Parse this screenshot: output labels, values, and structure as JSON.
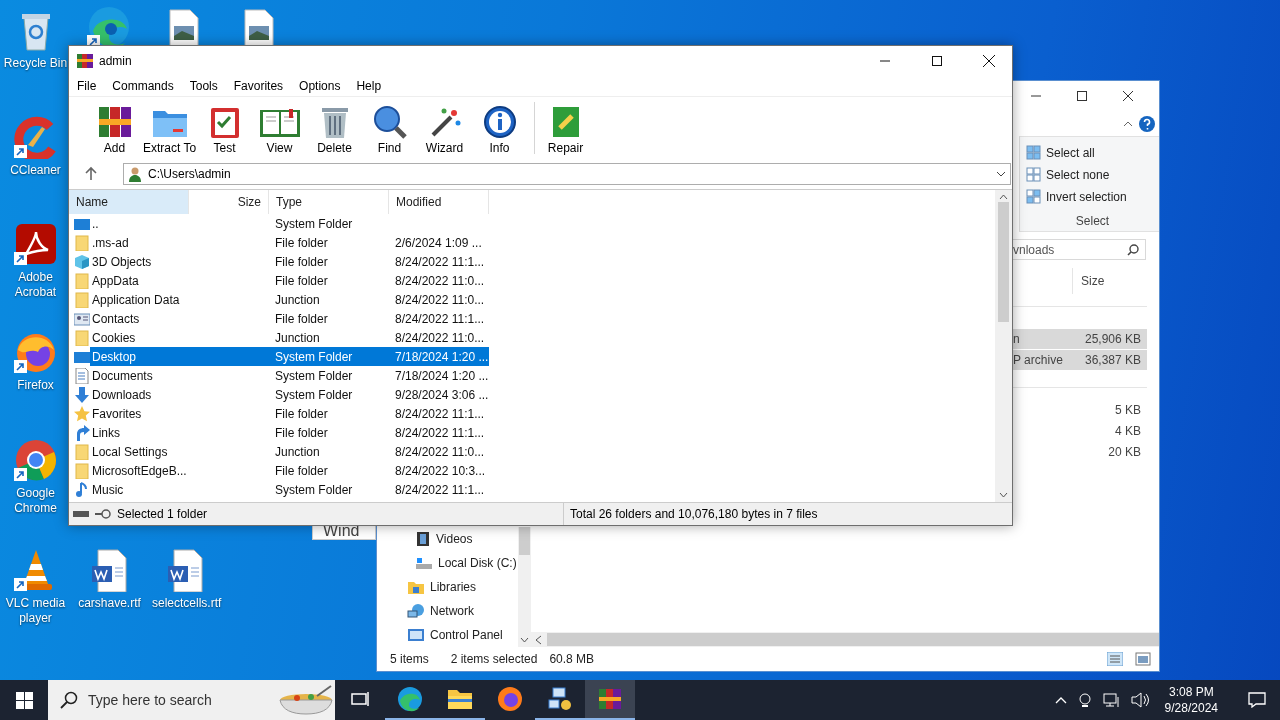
{
  "desktop_icons": [
    {
      "kind": "recycle",
      "label": "Recycle Bin",
      "shortcut": false
    },
    {
      "kind": "edge",
      "shortcut": true
    },
    {
      "kind": "image",
      "shortcut": false
    },
    {
      "kind": "image",
      "shortcut": false
    },
    {
      "kind": "ccleaner",
      "label": "CCleaner",
      "shortcut": true
    },
    {
      "kind": "acrobat",
      "label": "Adobe Acrobat",
      "shortcut": true
    },
    {
      "kind": "firefox",
      "label": "Firefox",
      "shortcut": true
    },
    {
      "kind": "chrome",
      "label": "Google Chrome",
      "shortcut": true
    },
    {
      "kind": "vlc",
      "label": "VLC media player",
      "shortcut": true
    },
    {
      "kind": "word",
      "label": "carshave.rtf",
      "shortcut": false
    },
    {
      "kind": "word",
      "label": "selectcells.rtf",
      "shortcut": false
    }
  ],
  "backdrop_fragment": {
    "text": "Wind"
  },
  "explorer": {
    "ribbon": {
      "commands": [
        {
          "kind": "all",
          "label": "Select all"
        },
        {
          "kind": "none",
          "label": "Select none"
        },
        {
          "kind": "invert",
          "label": "Invert selection"
        }
      ],
      "group_label": "Select"
    },
    "search": {
      "value": "vnloads"
    },
    "column": "Size",
    "rows": [
      {
        "name": "n",
        "size": "25,906 KB",
        "selected": true
      },
      {
        "name": "P archive",
        "size": "36,387 KB",
        "selected": true
      },
      {
        "size": "5 KB",
        "selected": false
      },
      {
        "size": "4 KB",
        "selected": false
      },
      {
        "size": "20 KB",
        "selected": false
      }
    ],
    "nav": [
      {
        "children": [
          {
            "kind": "videos",
            "label": "Videos"
          },
          {
            "kind": "disk",
            "label": "Local Disk (C:)"
          }
        ]
      },
      {
        "kind": "libraries",
        "label": "Libraries"
      },
      {
        "kind": "network",
        "label": "Network"
      },
      {
        "kind": "control",
        "label": "Control Panel"
      }
    ],
    "status": [
      "5 items",
      "2 items selected",
      "60.8 MB"
    ]
  },
  "winrar": {
    "title": "admin",
    "menu": [
      "File",
      "Commands",
      "Tools",
      "Favorites",
      "Options",
      "Help"
    ],
    "toolbar": [
      {
        "kind": "add",
        "label": "Add"
      },
      {
        "kind": "extract",
        "label": "Extract To"
      },
      {
        "kind": "test",
        "label": "Test"
      },
      {
        "kind": "view",
        "label": "View"
      },
      {
        "kind": "delete",
        "label": "Delete"
      },
      {
        "kind": "find",
        "label": "Find"
      },
      {
        "kind": "wizard",
        "label": "Wizard"
      },
      {
        "kind": "info",
        "label": "Info"
      },
      {
        "kind": "separator"
      },
      {
        "kind": "repair",
        "label": "Repair"
      }
    ],
    "path": "C:\\Users\\admin",
    "columns": [
      {
        "label": "Name",
        "sorted": true
      },
      {
        "label": "Size",
        "sorted": false
      },
      {
        "label": "Type",
        "sorted": false
      },
      {
        "label": "Modified",
        "sorted": false
      }
    ],
    "rows": [
      {
        "kind": "sysfolder",
        "name": "..",
        "type": "System Folder",
        "selected": false
      },
      {
        "kind": "folder",
        "name": ".ms-ad",
        "type": "File folder",
        "modified": "2/6/2024 1:09 ...",
        "selected": false
      },
      {
        "kind": "cube",
        "name": "3D Objects",
        "type": "File folder",
        "modified": "8/24/2022 11:1...",
        "selected": false
      },
      {
        "kind": "folder",
        "name": "AppData",
        "type": "File folder",
        "modified": "8/24/2022 11:0...",
        "selected": false
      },
      {
        "kind": "folder",
        "name": "Application Data",
        "type": "Junction",
        "modified": "8/24/2022 11:0...",
        "selected": false
      },
      {
        "kind": "contacts",
        "name": "Contacts",
        "type": "File folder",
        "modified": "8/24/2022 11:1...",
        "selected": false
      },
      {
        "kind": "folder",
        "name": "Cookies",
        "type": "Junction",
        "modified": "8/24/2022 11:0...",
        "selected": false
      },
      {
        "kind": "sysfolder",
        "name": "Desktop",
        "type": "System Folder",
        "modified": "7/18/2024 1:20 ...",
        "selected": true
      },
      {
        "kind": "document",
        "name": "Documents",
        "type": "System Folder",
        "modified": "7/18/2024 1:20 ...",
        "selected": false
      },
      {
        "kind": "download",
        "name": "Downloads",
        "type": "System Folder",
        "modified": "9/28/2024 3:06 ...",
        "selected": false
      },
      {
        "kind": "star",
        "name": "Favorites",
        "type": "File folder",
        "modified": "8/24/2022 11:1...",
        "selected": false
      },
      {
        "kind": "link",
        "name": "Links",
        "type": "File folder",
        "modified": "8/24/2022 11:1...",
        "selected": false
      },
      {
        "kind": "folder",
        "name": "Local Settings",
        "type": "Junction",
        "modified": "8/24/2022 11:0...",
        "selected": false
      },
      {
        "kind": "folder",
        "name": "MicrosoftEdgeB...",
        "type": "File folder",
        "modified": "8/24/2022 10:3...",
        "selected": false
      },
      {
        "kind": "music",
        "name": "Music",
        "type": "System Folder",
        "modified": "8/24/2022 11:1...",
        "selected": false
      }
    ],
    "status_left": "Selected 1 folder",
    "status_right": "Total 26 folders and 10,076,180 bytes in 7 files"
  },
  "taskbar": {
    "search_placeholder": "Type here to search",
    "apps": [
      {
        "kind": "taskview",
        "running": false,
        "selected": false
      },
      {
        "kind": "edge",
        "running": true,
        "selected": false
      },
      {
        "kind": "explorer",
        "running": true,
        "selected": false
      },
      {
        "kind": "firefox",
        "running": false,
        "selected": false
      },
      {
        "kind": "network-app",
        "running": true,
        "selected": false
      },
      {
        "kind": "winrar",
        "running": true,
        "selected": true
      }
    ],
    "time": "3:08 PM",
    "date": "9/28/2024"
  }
}
